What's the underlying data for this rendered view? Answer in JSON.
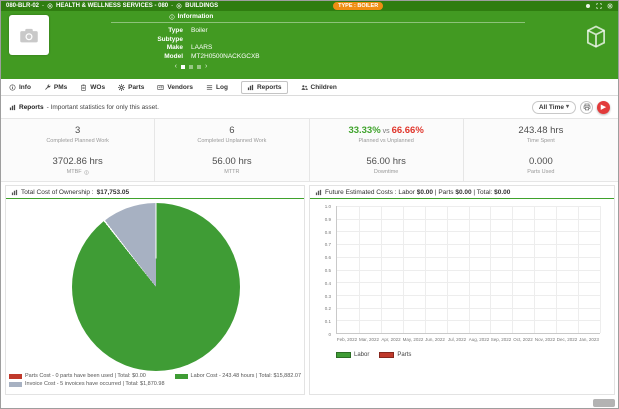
{
  "topbar": {
    "breadcrumb": [
      "080-BLR-02",
      "HEALTH & WELLNESS SERVICES - 080",
      "BUILDINGS"
    ],
    "separator": "-",
    "type_badge": "TYPE : BOILER"
  },
  "header": {
    "panel_title": "Information",
    "fields": [
      {
        "label": "Type",
        "value": "Boiler"
      },
      {
        "label": "Subtype",
        "value": ""
      },
      {
        "label": "Make",
        "value": "LAARS"
      },
      {
        "label": "Model",
        "value": "MT2H0500NACKGCXB"
      }
    ],
    "carousel": {
      "dots": 3,
      "active_index": 0
    }
  },
  "tabs": [
    {
      "label": "Info",
      "icon": "info-icon",
      "active": false
    },
    {
      "label": "PMs",
      "icon": "wrench-icon",
      "active": false
    },
    {
      "label": "WOs",
      "icon": "clipboard-icon",
      "active": false
    },
    {
      "label": "Parts",
      "icon": "gear-icon",
      "active": false
    },
    {
      "label": "Vendors",
      "icon": "vendor-card-icon",
      "active": false
    },
    {
      "label": "Log",
      "icon": "list-icon",
      "active": false
    },
    {
      "label": "Reports",
      "icon": "chart-icon",
      "active": true
    },
    {
      "label": "Children",
      "icon": "people-icon",
      "active": false
    }
  ],
  "reports_bar": {
    "title": "Reports",
    "subtitle": "- Important statistics for only this asset.",
    "time_filter_label": "All Time"
  },
  "stats": [
    {
      "value": "3",
      "label": "Completed Planned Work"
    },
    {
      "value": "6",
      "label": "Completed Unplanned Work"
    },
    {
      "value": "33.33%",
      "value_color": "#3fa32c",
      "join": "vs",
      "value2": "66.66%",
      "value2_color": "#e0352b",
      "label": "Planned vs Unplanned"
    },
    {
      "value": "243.48 hrs",
      "label": "Time Spent"
    },
    {
      "value": "3702.86 hrs",
      "label": "MTBF",
      "info": true
    },
    {
      "value": "56.00 hrs",
      "label": "MTTR"
    },
    {
      "value": "56.00 hrs",
      "label": "Downtime"
    },
    {
      "value": "0.000",
      "label": "Parts Used"
    }
  ],
  "chart_data": [
    {
      "type": "pie",
      "title": "Total Cost of Ownership : $17,753.05",
      "title_prefix": "Total Cost of Ownership :",
      "title_value": "$17,753.05",
      "total": 17753.05,
      "slices": [
        {
          "name": "Parts Cost",
          "value": 0,
          "color": "#c0392b",
          "legend": "Parts Cost - 0 parts have been used | Total: $0.00"
        },
        {
          "name": "Labor Cost",
          "value": 15882.07,
          "color": "#3f9c35",
          "legend": "Labor Cost - 243.48 hours | Total: $15,882.07"
        },
        {
          "name": "Invoice Cost",
          "value": 1870.98,
          "color": "#a7b1c2",
          "legend": "Invoice Cost - 5 invoices have occurred | Total: $1,870.98"
        }
      ]
    },
    {
      "type": "bar",
      "title": "Future Estimated Costs : Labor $0.00 | Parts $0.00 | Total: $0.00",
      "title_segments": [
        {
          "text": "Future Estimated Costs : Labor ",
          "bold": false
        },
        {
          "text": "$0.00",
          "bold": true
        },
        {
          "text": " | Parts ",
          "bold": false
        },
        {
          "text": "$0.00",
          "bold": true
        },
        {
          "text": " | Total: ",
          "bold": false
        },
        {
          "text": "$0.00",
          "bold": true
        }
      ],
      "categories": [
        "Feb, 2022",
        "Mar, 2022",
        "Apr, 2022",
        "May, 2022",
        "Jun, 2022",
        "Jul, 2022",
        "Aug, 2022",
        "Sep, 2022",
        "Oct, 2022",
        "Nov, 2022",
        "Dec, 2022",
        "Jan, 2023"
      ],
      "series": [
        {
          "name": "Labor",
          "color": "#3f9c35",
          "values": [
            0,
            0,
            0,
            0,
            0,
            0,
            0,
            0,
            0,
            0,
            0,
            0
          ]
        },
        {
          "name": "Parts",
          "color": "#c0392b",
          "values": [
            0,
            0,
            0,
            0,
            0,
            0,
            0,
            0,
            0,
            0,
            0,
            0
          ]
        }
      ],
      "ylim": [
        0,
        1
      ],
      "yticks": [
        "1.0",
        "0.9",
        "0.8",
        "0.7",
        "0.6",
        "0.5",
        "0.4",
        "0.3",
        "0.2",
        "0.1",
        "0"
      ],
      "grid": true,
      "legend_position": "bottom-left"
    }
  ],
  "colors": {
    "topbar_bg": "#2f7d10",
    "header_bg": "#429a22",
    "badge_bg": "#ef8e13",
    "accent_green": "#3fa22c",
    "accent_red": "#e0352b",
    "play_button": "#e23b3b"
  }
}
